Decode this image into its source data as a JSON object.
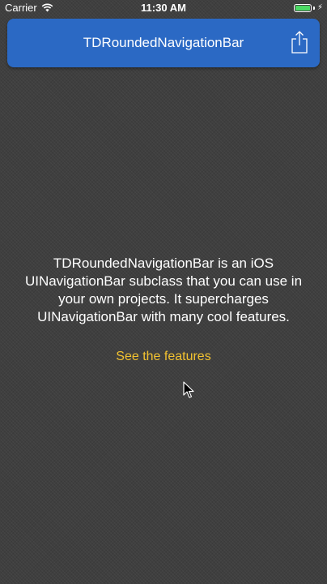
{
  "status_bar": {
    "carrier": "Carrier",
    "time": "11:30 AM",
    "battery_level": 1.0,
    "battery_color": "#4cd964",
    "charging": true
  },
  "navbar": {
    "title": "TDRoundedNavigationBar",
    "background_color": "#2b69c4",
    "share_icon": "share-icon"
  },
  "main": {
    "description": "TDRoundedNavigationBar is an iOS UINavigationBar subclass that you can use in your own projects. It supercharges UINavigationBar with many cool features.",
    "features_link": "See the features",
    "link_color": "#f2c230"
  }
}
